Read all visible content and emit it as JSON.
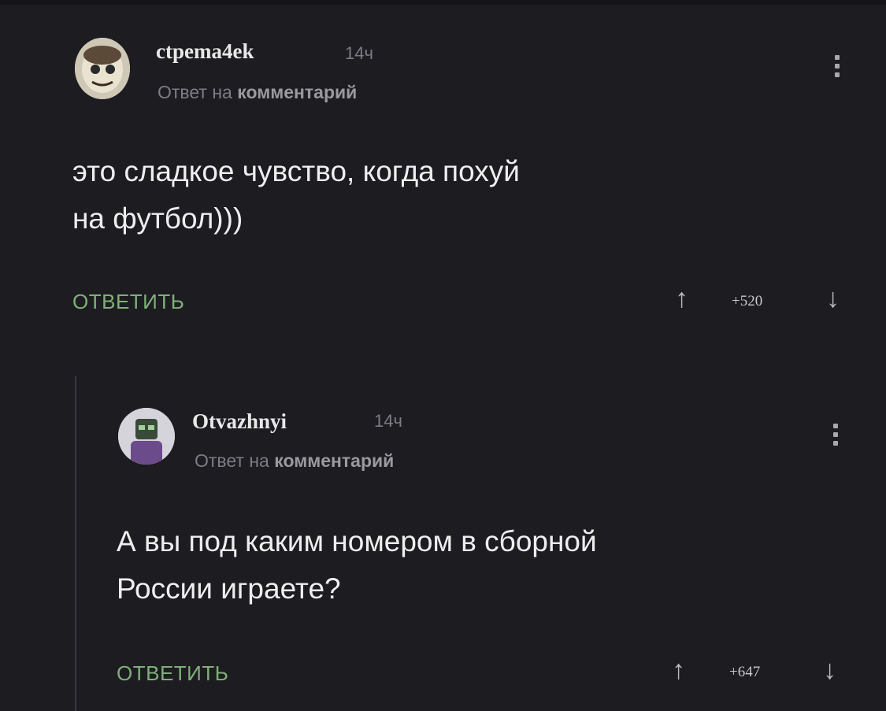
{
  "comments": [
    {
      "username": "ctpema4ek",
      "time": "14ч",
      "subtitle_prefix": "Ответ на",
      "subtitle_link": "комментарий",
      "text_line1": "это сладкое чувство, когда похуй",
      "text_line2": "на футбол)))",
      "reply_label": "ОТВЕТИТЬ",
      "rating": "+520",
      "upvote_icon": "↑",
      "downvote_icon": "↓"
    },
    {
      "username": "Otvazhnyi",
      "time": "14ч",
      "subtitle_prefix": "Ответ на",
      "subtitle_link": "комментарий",
      "text_line1": "А вы под каким номером в сборной",
      "text_line2": "России играете?",
      "reply_label": "ОТВЕТИТЬ",
      "rating": "+647",
      "upvote_icon": "↑",
      "downvote_icon": "↓"
    }
  ],
  "colors": {
    "background": "#1d1c21",
    "reply_button": "#7fb07a",
    "muted_text": "#7d7c82"
  }
}
